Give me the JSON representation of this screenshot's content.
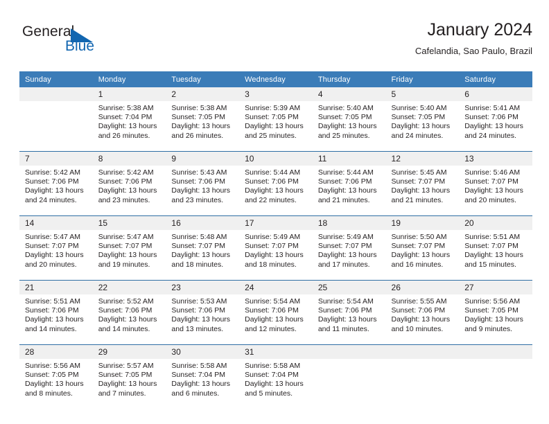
{
  "brand": {
    "name_part1": "General",
    "name_part2": "Blue",
    "triangle_color": "#1266b0",
    "text_color": "#231f20"
  },
  "header": {
    "title": "January 2024",
    "subtitle": "Cafelandia, Sao Paulo, Brazil"
  },
  "theme": {
    "header_blue": "#3b7cb8",
    "separator_blue": "#2e6da4",
    "daynum_band": "#f0f0f0",
    "text": "#231f20"
  },
  "weekday_headers": [
    "Sunday",
    "Monday",
    "Tuesday",
    "Wednesday",
    "Thursday",
    "Friday",
    "Saturday"
  ],
  "weeks": [
    {
      "days": [
        {
          "num": "",
          "sunrise": "",
          "sunset": "",
          "daylight_line1": "",
          "daylight_line2": ""
        },
        {
          "num": "1",
          "sunrise": "Sunrise: 5:38 AM",
          "sunset": "Sunset: 7:04 PM",
          "daylight_line1": "Daylight: 13 hours",
          "daylight_line2": "and 26 minutes."
        },
        {
          "num": "2",
          "sunrise": "Sunrise: 5:38 AM",
          "sunset": "Sunset: 7:05 PM",
          "daylight_line1": "Daylight: 13 hours",
          "daylight_line2": "and 26 minutes."
        },
        {
          "num": "3",
          "sunrise": "Sunrise: 5:39 AM",
          "sunset": "Sunset: 7:05 PM",
          "daylight_line1": "Daylight: 13 hours",
          "daylight_line2": "and 25 minutes."
        },
        {
          "num": "4",
          "sunrise": "Sunrise: 5:40 AM",
          "sunset": "Sunset: 7:05 PM",
          "daylight_line1": "Daylight: 13 hours",
          "daylight_line2": "and 25 minutes."
        },
        {
          "num": "5",
          "sunrise": "Sunrise: 5:40 AM",
          "sunset": "Sunset: 7:05 PM",
          "daylight_line1": "Daylight: 13 hours",
          "daylight_line2": "and 24 minutes."
        },
        {
          "num": "6",
          "sunrise": "Sunrise: 5:41 AM",
          "sunset": "Sunset: 7:06 PM",
          "daylight_line1": "Daylight: 13 hours",
          "daylight_line2": "and 24 minutes."
        }
      ]
    },
    {
      "days": [
        {
          "num": "7",
          "sunrise": "Sunrise: 5:42 AM",
          "sunset": "Sunset: 7:06 PM",
          "daylight_line1": "Daylight: 13 hours",
          "daylight_line2": "and 24 minutes."
        },
        {
          "num": "8",
          "sunrise": "Sunrise: 5:42 AM",
          "sunset": "Sunset: 7:06 PM",
          "daylight_line1": "Daylight: 13 hours",
          "daylight_line2": "and 23 minutes."
        },
        {
          "num": "9",
          "sunrise": "Sunrise: 5:43 AM",
          "sunset": "Sunset: 7:06 PM",
          "daylight_line1": "Daylight: 13 hours",
          "daylight_line2": "and 23 minutes."
        },
        {
          "num": "10",
          "sunrise": "Sunrise: 5:44 AM",
          "sunset": "Sunset: 7:06 PM",
          "daylight_line1": "Daylight: 13 hours",
          "daylight_line2": "and 22 minutes."
        },
        {
          "num": "11",
          "sunrise": "Sunrise: 5:44 AM",
          "sunset": "Sunset: 7:06 PM",
          "daylight_line1": "Daylight: 13 hours",
          "daylight_line2": "and 21 minutes."
        },
        {
          "num": "12",
          "sunrise": "Sunrise: 5:45 AM",
          "sunset": "Sunset: 7:07 PM",
          "daylight_line1": "Daylight: 13 hours",
          "daylight_line2": "and 21 minutes."
        },
        {
          "num": "13",
          "sunrise": "Sunrise: 5:46 AM",
          "sunset": "Sunset: 7:07 PM",
          "daylight_line1": "Daylight: 13 hours",
          "daylight_line2": "and 20 minutes."
        }
      ]
    },
    {
      "days": [
        {
          "num": "14",
          "sunrise": "Sunrise: 5:47 AM",
          "sunset": "Sunset: 7:07 PM",
          "daylight_line1": "Daylight: 13 hours",
          "daylight_line2": "and 20 minutes."
        },
        {
          "num": "15",
          "sunrise": "Sunrise: 5:47 AM",
          "sunset": "Sunset: 7:07 PM",
          "daylight_line1": "Daylight: 13 hours",
          "daylight_line2": "and 19 minutes."
        },
        {
          "num": "16",
          "sunrise": "Sunrise: 5:48 AM",
          "sunset": "Sunset: 7:07 PM",
          "daylight_line1": "Daylight: 13 hours",
          "daylight_line2": "and 18 minutes."
        },
        {
          "num": "17",
          "sunrise": "Sunrise: 5:49 AM",
          "sunset": "Sunset: 7:07 PM",
          "daylight_line1": "Daylight: 13 hours",
          "daylight_line2": "and 18 minutes."
        },
        {
          "num": "18",
          "sunrise": "Sunrise: 5:49 AM",
          "sunset": "Sunset: 7:07 PM",
          "daylight_line1": "Daylight: 13 hours",
          "daylight_line2": "and 17 minutes."
        },
        {
          "num": "19",
          "sunrise": "Sunrise: 5:50 AM",
          "sunset": "Sunset: 7:07 PM",
          "daylight_line1": "Daylight: 13 hours",
          "daylight_line2": "and 16 minutes."
        },
        {
          "num": "20",
          "sunrise": "Sunrise: 5:51 AM",
          "sunset": "Sunset: 7:07 PM",
          "daylight_line1": "Daylight: 13 hours",
          "daylight_line2": "and 15 minutes."
        }
      ]
    },
    {
      "days": [
        {
          "num": "21",
          "sunrise": "Sunrise: 5:51 AM",
          "sunset": "Sunset: 7:06 PM",
          "daylight_line1": "Daylight: 13 hours",
          "daylight_line2": "and 14 minutes."
        },
        {
          "num": "22",
          "sunrise": "Sunrise: 5:52 AM",
          "sunset": "Sunset: 7:06 PM",
          "daylight_line1": "Daylight: 13 hours",
          "daylight_line2": "and 14 minutes."
        },
        {
          "num": "23",
          "sunrise": "Sunrise: 5:53 AM",
          "sunset": "Sunset: 7:06 PM",
          "daylight_line1": "Daylight: 13 hours",
          "daylight_line2": "and 13 minutes."
        },
        {
          "num": "24",
          "sunrise": "Sunrise: 5:54 AM",
          "sunset": "Sunset: 7:06 PM",
          "daylight_line1": "Daylight: 13 hours",
          "daylight_line2": "and 12 minutes."
        },
        {
          "num": "25",
          "sunrise": "Sunrise: 5:54 AM",
          "sunset": "Sunset: 7:06 PM",
          "daylight_line1": "Daylight: 13 hours",
          "daylight_line2": "and 11 minutes."
        },
        {
          "num": "26",
          "sunrise": "Sunrise: 5:55 AM",
          "sunset": "Sunset: 7:06 PM",
          "daylight_line1": "Daylight: 13 hours",
          "daylight_line2": "and 10 minutes."
        },
        {
          "num": "27",
          "sunrise": "Sunrise: 5:56 AM",
          "sunset": "Sunset: 7:05 PM",
          "daylight_line1": "Daylight: 13 hours",
          "daylight_line2": "and 9 minutes."
        }
      ]
    },
    {
      "days": [
        {
          "num": "28",
          "sunrise": "Sunrise: 5:56 AM",
          "sunset": "Sunset: 7:05 PM",
          "daylight_line1": "Daylight: 13 hours",
          "daylight_line2": "and 8 minutes."
        },
        {
          "num": "29",
          "sunrise": "Sunrise: 5:57 AM",
          "sunset": "Sunset: 7:05 PM",
          "daylight_line1": "Daylight: 13 hours",
          "daylight_line2": "and 7 minutes."
        },
        {
          "num": "30",
          "sunrise": "Sunrise: 5:58 AM",
          "sunset": "Sunset: 7:04 PM",
          "daylight_line1": "Daylight: 13 hours",
          "daylight_line2": "and 6 minutes."
        },
        {
          "num": "31",
          "sunrise": "Sunrise: 5:58 AM",
          "sunset": "Sunset: 7:04 PM",
          "daylight_line1": "Daylight: 13 hours",
          "daylight_line2": "and 5 minutes."
        },
        {
          "num": "",
          "sunrise": "",
          "sunset": "",
          "daylight_line1": "",
          "daylight_line2": ""
        },
        {
          "num": "",
          "sunrise": "",
          "sunset": "",
          "daylight_line1": "",
          "daylight_line2": ""
        },
        {
          "num": "",
          "sunrise": "",
          "sunset": "",
          "daylight_line1": "",
          "daylight_line2": ""
        }
      ]
    }
  ]
}
